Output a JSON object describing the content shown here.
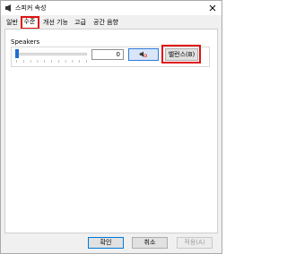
{
  "window": {
    "title": "스피커 속성"
  },
  "tabs": [
    {
      "label": "일반",
      "active": false
    },
    {
      "label": "수준",
      "active": true
    },
    {
      "label": "개선 기능",
      "active": false
    },
    {
      "label": "고급",
      "active": false
    },
    {
      "label": "공간 음향",
      "active": false
    }
  ],
  "levels": {
    "device_label": "Speakers",
    "volume_value": "0",
    "volume_fraction": 0,
    "mute_icon": "speaker-muted-icon",
    "balance_label": "밸런스(B)"
  },
  "footer": {
    "ok_label": "확인",
    "cancel_label": "취소",
    "apply_label": "적용(A)"
  },
  "colors": {
    "highlight": "#e01313",
    "accent": "#1f6fd1"
  }
}
